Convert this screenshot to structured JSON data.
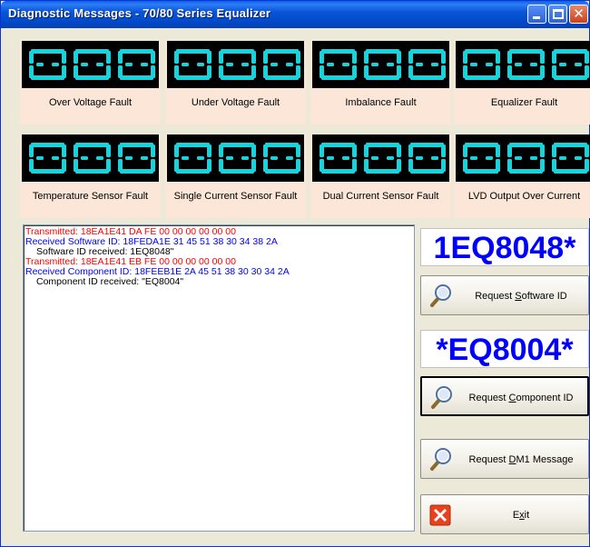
{
  "window": {
    "title": "Diagnostic Messages - 70/80 Series Equalizer"
  },
  "faults": [
    {
      "label": "Over Voltage Fault"
    },
    {
      "label": "Under Voltage Fault"
    },
    {
      "label": "Imbalance Fault"
    },
    {
      "label": "Equalizer Fault"
    },
    {
      "label": "Temperature Sensor Fault"
    },
    {
      "label": "Single Current Sensor Fault"
    },
    {
      "label": "Dual Current Sensor Fault"
    },
    {
      "label": "LVD Output Over Current"
    }
  ],
  "log": {
    "lines": [
      {
        "text": "Transmitted: 18EA1E41 DA FE 00 00 00 00 00 00",
        "color": "#ff0000"
      },
      {
        "text": "Received Software ID: 18FEDA1E 31 45 51 38 30 34 38 2A",
        "color": "#0000ff"
      },
      {
        "text": "Software ID received: 1EQ8048\"",
        "color": "#000000"
      },
      {
        "text": "Transmitted: 18EA1E41 EB FE 00 00 00 00 00 00",
        "color": "#ff0000"
      },
      {
        "text": "Received Component ID: 18FEEB1E 2A 45 51 38 30 30 34 2A",
        "color": "#0000ff"
      },
      {
        "text": "Component ID received: \"EQ8004\"",
        "color": "#000000"
      }
    ]
  },
  "software_id_display": "1EQ8048*",
  "component_id_display": "*EQ8004*",
  "buttons": {
    "request_software_id": {
      "pre": "Request ",
      "accel": "S",
      "post": "oftware ID",
      "icon": "magnifier-icon"
    },
    "request_component_id": {
      "pre": "Request ",
      "accel": "C",
      "post": "omponent ID",
      "icon": "magnifier-icon"
    },
    "request_dm1": {
      "pre": "Request ",
      "accel": "D",
      "post": "M1 Message",
      "icon": "magnifier-icon"
    },
    "exit": {
      "pre": "E",
      "accel": "x",
      "post": "it",
      "icon": "close-x-icon"
    }
  },
  "colors": {
    "segment": "#17d3dc",
    "id_text": "#0000ff",
    "title_bar": "#0a56d8",
    "fault_bg": "#fbe6d8"
  }
}
